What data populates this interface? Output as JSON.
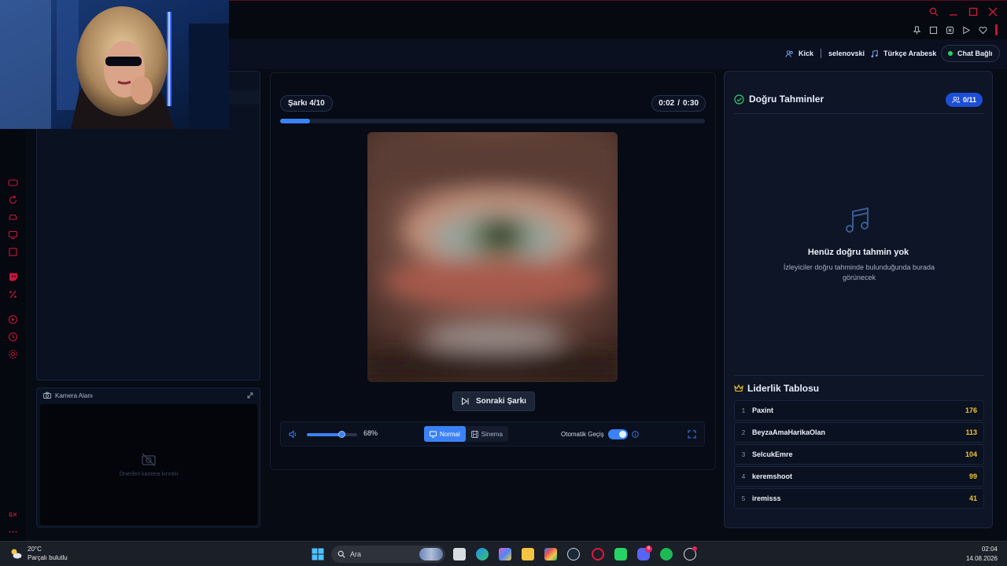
{
  "header": {
    "platform": "Kick",
    "channel": "selenovski",
    "genre": "Türkçe Arabesk",
    "chat_status": "Chat Bağlı"
  },
  "player": {
    "song_counter": "Şarkı 4/10",
    "elapsed": "0:02",
    "time_separator": "/",
    "duration": "0:30",
    "progress": 0.07,
    "next_label": "Sonraki Şarkı",
    "volume": 68,
    "volume_label": "68%",
    "mode_normal": "Normal",
    "mode_cinema": "Sinema",
    "active_mode": "Normal",
    "auto_label": "Otomatik Geçiş",
    "auto_enabled": true
  },
  "camera": {
    "title": "Kamera Alanı",
    "placeholder": "Önerileri kamera kırıntılı"
  },
  "guesses": {
    "title": "Doğru Tahminler",
    "count": "0/11",
    "empty_title": "Henüz doğru tahmin yok",
    "empty_desc": "İzleyiciler doğru tahminde bulunduğunda burada görünecek"
  },
  "leaderboard": {
    "title": "Liderlik Tablosu",
    "rows": [
      {
        "rank": "1",
        "name": "Paxint",
        "score": "176"
      },
      {
        "rank": "2",
        "name": "BeyzaAmaHarikaOlan",
        "score": "113"
      },
      {
        "rank": "3",
        "name": "SelcukEmre",
        "score": "104"
      },
      {
        "rank": "4",
        "name": "keremshoot",
        "score": "99"
      },
      {
        "rank": "5",
        "name": "iremisss",
        "score": "41"
      }
    ]
  },
  "taskbar": {
    "temperature": "20°C",
    "weather": "Parçalı bulutlu",
    "search_placeholder": "Ara",
    "time": "02:04",
    "date": "14.08.2026",
    "discord_badge": "8"
  },
  "colors": {
    "accent": "#3b82f6",
    "score": "#f4c430",
    "online": "#27d36b",
    "brand_red": "#c1163a"
  },
  "icons": [
    "search-icon",
    "minimize-icon",
    "maximize-icon",
    "close-icon",
    "pin-icon",
    "users-icon",
    "music-note-icon",
    "check-circle-icon",
    "crown-icon",
    "volume-icon",
    "monitor-icon",
    "film-icon",
    "info-icon",
    "fullscreen-icon",
    "camera-icon",
    "camera-off-icon",
    "skip-next-icon"
  ]
}
